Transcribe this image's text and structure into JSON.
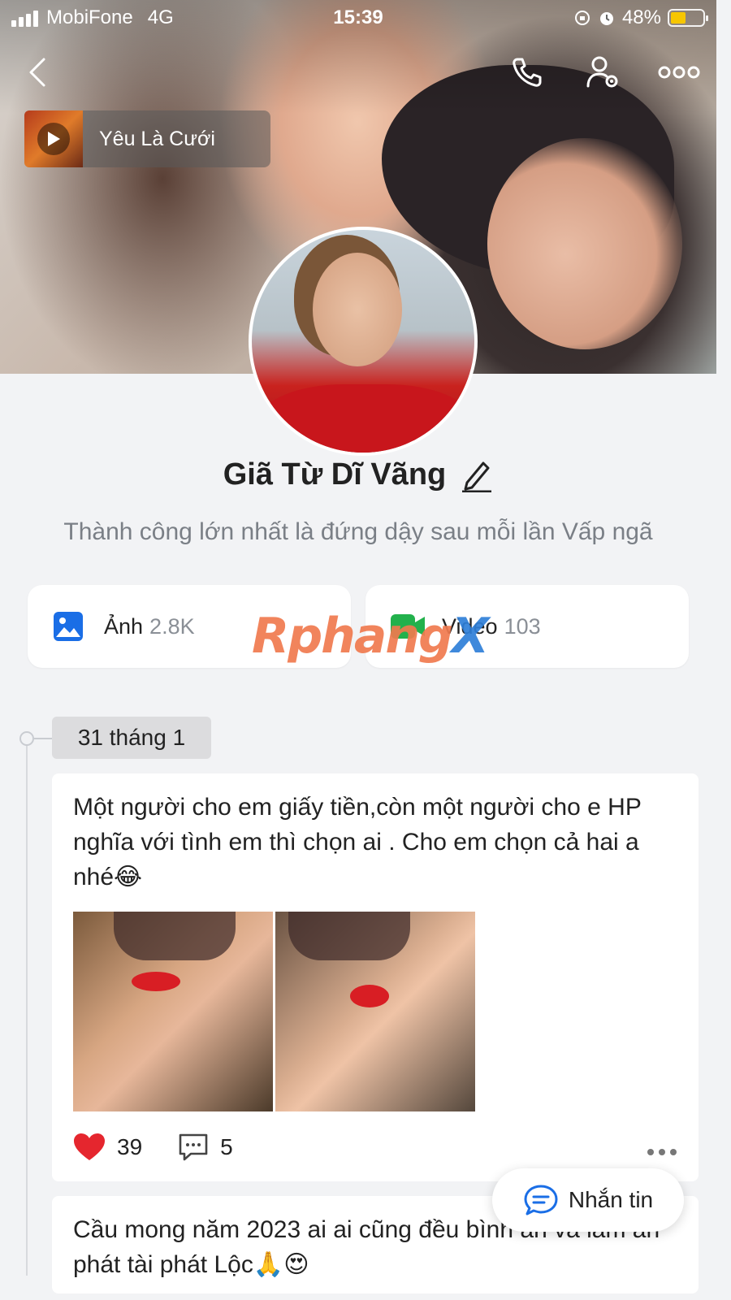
{
  "status_bar": {
    "carrier": "MobiFone",
    "network": "4G",
    "time": "15:39",
    "battery": "48%",
    "battery_level": 0.48
  },
  "header": {
    "back_icon": "chevron-left-icon",
    "call_icon": "phone-icon",
    "settings_icon": "user-settings-icon",
    "more_icon": "more-horizontal-icon"
  },
  "music": {
    "title": "Yêu Là Cưới",
    "icon": "play-icon"
  },
  "profile": {
    "name": "Giã Từ Dĩ Vãng",
    "edit_icon": "pencil-icon",
    "bio": "Thành công lớn nhất là đứng dậy sau mỗi lần Vấp ngã"
  },
  "media": {
    "photos": {
      "label": "Ảnh",
      "count": "2.8K",
      "icon": "image-icon",
      "icon_color": "#1a6ee6"
    },
    "videos": {
      "label": "Video",
      "count": "103",
      "icon": "video-camera-icon",
      "icon_color": "#22b14c"
    }
  },
  "watermark": {
    "part1": "Rphang",
    "part2": "X"
  },
  "timeline": {
    "date": "31 tháng 1"
  },
  "posts": [
    {
      "text": "Một người cho em giấy tiền,còn một người cho e HP nghĩa với tình em thì chọn ai . Cho em chọn cả hai a nhé😂",
      "likes": "39",
      "comments": "5"
    },
    {
      "text": "Cầu mong năm 2023 ai ai cũng đều bình an và làm ăn phát tài phát Lộc🙏😍"
    }
  ],
  "fab": {
    "label": "Nhắn tin",
    "icon": "chat-bubble-icon",
    "accent": "#1a6ee6"
  }
}
